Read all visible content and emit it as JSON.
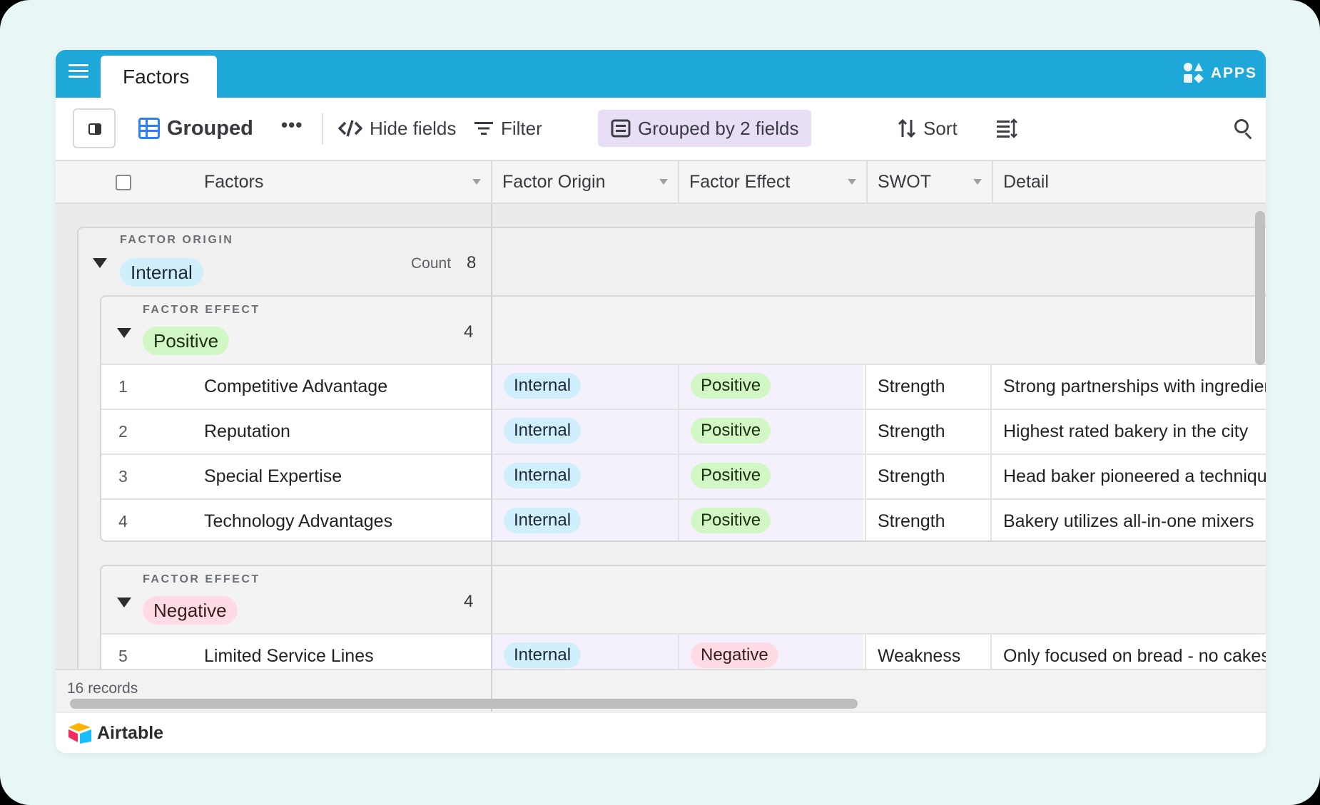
{
  "topbar": {
    "tab_active": "Factors",
    "apps_label": "APPS"
  },
  "toolbar": {
    "view_name": "Grouped",
    "more": "•••",
    "hide_fields": "Hide fields",
    "filter": "Filter",
    "grouped_by": "Grouped by 2 fields",
    "sort": "Sort"
  },
  "columns": {
    "factors": "Factors",
    "factor_origin": "Factor Origin",
    "factor_effect": "Factor Effect",
    "swot": "SWOT",
    "detail": "Detail"
  },
  "group1": {
    "label": "FACTOR ORIGIN",
    "value": "Internal",
    "count_label": "Count",
    "count": "8",
    "sub_positive": {
      "label": "FACTOR EFFECT",
      "value": "Positive",
      "count": "4",
      "rows": [
        {
          "num": "1",
          "name": "Competitive Advantage",
          "origin": "Internal",
          "effect": "Positive",
          "swot": "Strength",
          "detail": "Strong partnerships with ingredient"
        },
        {
          "num": "2",
          "name": "Reputation",
          "origin": "Internal",
          "effect": "Positive",
          "swot": "Strength",
          "detail": "Highest rated bakery in the city"
        },
        {
          "num": "3",
          "name": "Special Expertise",
          "origin": "Internal",
          "effect": "Positive",
          "swot": "Strength",
          "detail": "Head baker pioneered a technique"
        },
        {
          "num": "4",
          "name": "Technology Advantages",
          "origin": "Internal",
          "effect": "Positive",
          "swot": "Strength",
          "detail": "Bakery utilizes all-in-one mixers"
        }
      ]
    },
    "sub_negative": {
      "label": "FACTOR EFFECT",
      "value": "Negative",
      "count": "4",
      "rows": [
        {
          "num": "5",
          "name": "Limited Service Lines",
          "origin": "Internal",
          "effect": "Negative",
          "swot": "Weakness",
          "detail": "Only focused on bread - no cakes"
        }
      ]
    }
  },
  "footer": {
    "records": "16 records"
  },
  "brand": {
    "name": "Airtable"
  },
  "colors": {
    "topbar": "#1ea8d9",
    "accent_blue": "#2d7ff9",
    "grouped_bg": "#e8dff7"
  }
}
